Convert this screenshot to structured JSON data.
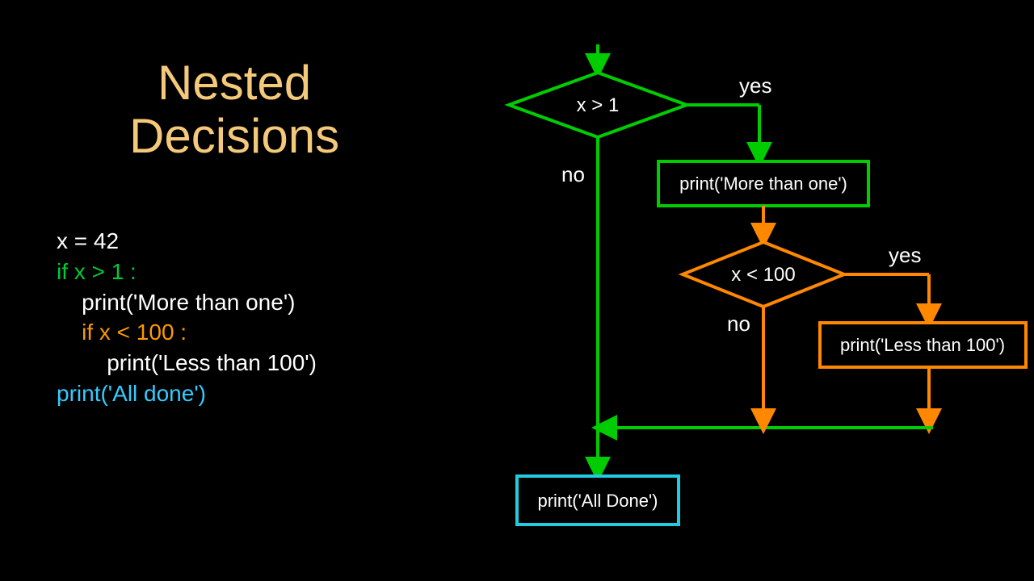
{
  "title_line1": "Nested",
  "title_line2": "Decisions",
  "code": {
    "l1": "x = 42",
    "l2": "if x > 1 :",
    "l3": "    print('More than one')",
    "l4": "    if x < 100 : ",
    "l5": "        print('Less than 100')",
    "l6": "print('All done')"
  },
  "flow": {
    "d1": "x > 1",
    "d1_yes": "yes",
    "d1_no": "no",
    "p1": "print('More than one')",
    "d2": "x < 100",
    "d2_yes": "yes",
    "d2_no": "no",
    "p2": "print('Less than 100')",
    "p3": "print('All Done')"
  }
}
